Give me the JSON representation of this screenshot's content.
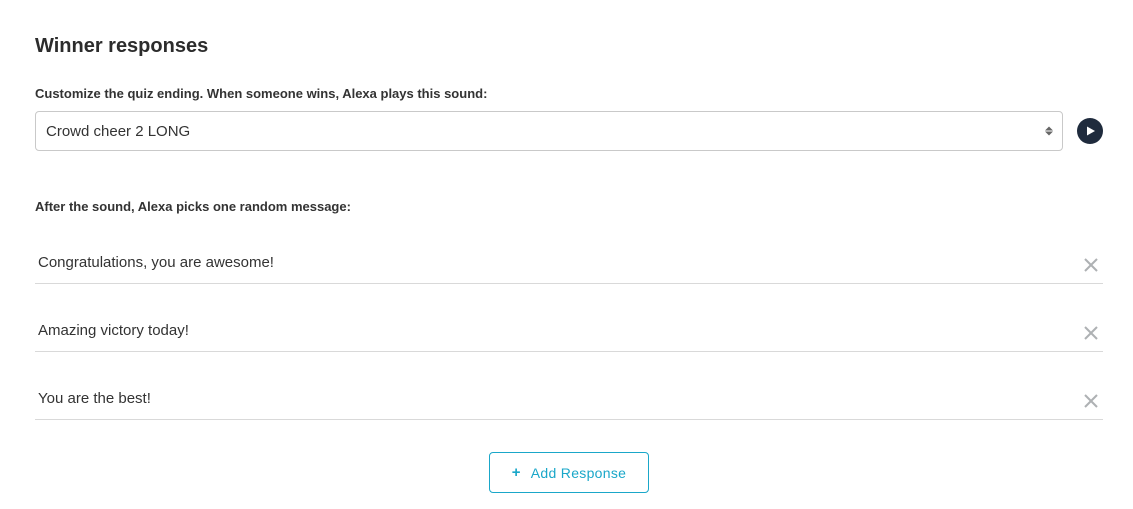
{
  "section": {
    "title": "Winner responses",
    "soundLabel": "Customize the quiz ending. When someone wins, Alexa plays this sound:",
    "soundValue": "Crowd cheer 2 LONG",
    "messageLabel": "After the sound, Alexa picks one random message:",
    "responses": [
      "Congratulations, you are awesome!",
      "Amazing victory today!",
      "You are the best!"
    ],
    "addButton": "Add Response"
  },
  "colors": {
    "accent": "#1aa7c9",
    "playBg": "#1f2b3d",
    "border": "#c9c9c9",
    "rule": "#d9d9d9",
    "closeIcon": "#aeb1b3"
  }
}
